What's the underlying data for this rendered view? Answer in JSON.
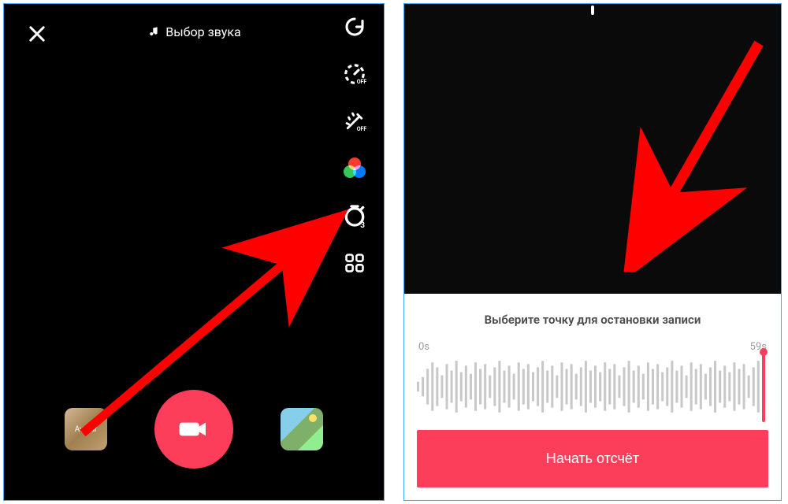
{
  "left": {
    "sound_label": "Выбор звука",
    "tools": {
      "flip": "flip",
      "speed": "speed",
      "speed_badge": "OFF",
      "beauty": "beauty",
      "beauty_badge": "OFF",
      "filters": "filters",
      "timer": "timer-3s",
      "timer_badge": "3",
      "more": "more"
    },
    "thumb_left_label": "Avatar"
  },
  "right": {
    "sheet_title": "Выберите точку для остановки записи",
    "range_start": "0s",
    "range_end": "59s",
    "start_button": "Начать отсчёт"
  },
  "colors": {
    "accent": "#fd3e5b",
    "arrow": "#ff0000"
  }
}
